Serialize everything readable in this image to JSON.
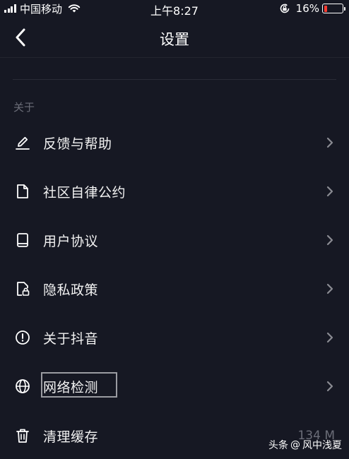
{
  "status_bar": {
    "carrier": "中国移动",
    "time": "上午8:27",
    "battery_percent": "16%",
    "battery_level": 0.16,
    "battery_color": "#ff3b30"
  },
  "nav": {
    "title": "设置"
  },
  "section": {
    "header": "关于"
  },
  "items": [
    {
      "label": "反馈与帮助",
      "icon": "pencil-icon"
    },
    {
      "label": "社区自律公约",
      "icon": "document-icon"
    },
    {
      "label": "用户协议",
      "icon": "book-icon"
    },
    {
      "label": "隐私政策",
      "icon": "locked-document-icon"
    },
    {
      "label": "关于抖音",
      "icon": "info-circle-icon"
    },
    {
      "label": "网络检测",
      "icon": "globe-icon"
    },
    {
      "label": "清理缓存",
      "icon": "trash-icon",
      "value": "134 M"
    }
  ],
  "watermark": {
    "source": "头条",
    "separator": "@",
    "author": "风中浅夏"
  },
  "colors": {
    "background": "#161823",
    "text": "#ffffff",
    "secondary_text": "#6b6d78"
  }
}
